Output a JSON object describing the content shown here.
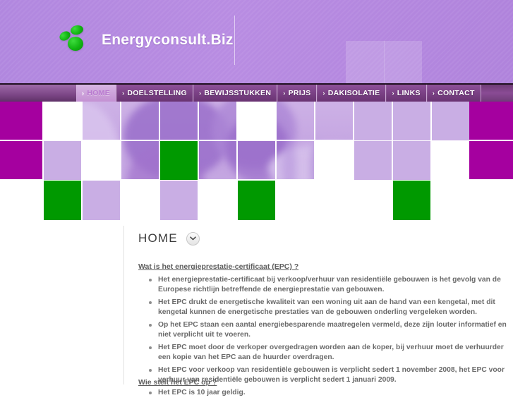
{
  "header": {
    "site_title": "Energyconsult.Biz",
    "logo_icon": "three-green-leaves-logo-icon",
    "brand_green": "#12b512",
    "brand_purple": "#b187df"
  },
  "nav": {
    "chevron": "›",
    "items": [
      {
        "label": "HOME",
        "active": true
      },
      {
        "label": "DOELSTELLING",
        "active": false
      },
      {
        "label": "BEWIJSSTUKKEN",
        "active": false
      },
      {
        "label": "PRIJS",
        "active": false
      },
      {
        "label": "DAKISOLATIE",
        "active": false
      },
      {
        "label": "LINKS",
        "active": false
      },
      {
        "label": "CONTACT",
        "active": false
      }
    ]
  },
  "banner": {
    "alt": "purple duotone photo mosaic of students studying",
    "accent_magenta": "#a5009f",
    "accent_green": "#009900",
    "accent_lilac": "#c9aee4"
  },
  "content": {
    "page_title": "HOME",
    "collapse_icon": "chevron-down-icon",
    "link_epc": "Wat is het energieprestatie-certificaat (EPC)",
    "link_epc_suffix": " ?",
    "link_wie": "Wie stelt het EPC op",
    "link_wie_suffix": " ?",
    "bullets": [
      "Het energieprestatie-certificaat bij verkoop/verhuur van residentiële gebouwen is het gevolg van de Europese richtlijn betreffende de energieprestatie van gebouwen.",
      "Het EPC drukt de energetische kwaliteit van een woning uit aan de hand van een kengetal, met dit kengetal kunnen de energetische prestaties van de gebouwen onderling vergeleken worden.",
      "Op het EPC staan een aantal energiebesparende maatregelen vermeld, deze zijn louter informatief en niet verplicht uit te voeren.",
      "Het  EPC moet door de verkoper overgedragen worden aan de koper, bij verhuur moet de verhuurder een kopie van het EPC aan de huurder overdragen.",
      "Het EPC voor verkoop van residentiële gebouwen is verplicht sedert 1 november 2008, het EPC voor verhuur van residentiële gebouwen is verplicht sedert 1 januari 2009.",
      "Het EPC is 10 jaar geldig."
    ]
  }
}
